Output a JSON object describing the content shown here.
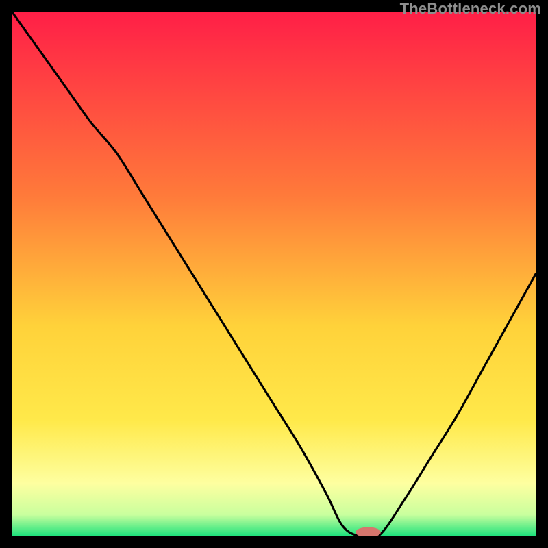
{
  "watermark": "TheBottleneck.com",
  "colors": {
    "black": "#000000",
    "red_top": "#ff1f47",
    "orange": "#ffa331",
    "yellow": "#ffe94a",
    "pale_yellow": "#feffa0",
    "green": "#1fe27c",
    "marker": "#d6766d",
    "curve": "#000000"
  },
  "chart_data": {
    "type": "line",
    "title": "",
    "xlabel": "",
    "ylabel": "",
    "xlim_note": "x in [0,1] fraction of plot width",
    "ylim_note": "y in [0,1] fraction of plot height, 0 at bottom",
    "x": [
      0.0,
      0.05,
      0.1,
      0.15,
      0.2,
      0.25,
      0.3,
      0.35,
      0.4,
      0.45,
      0.5,
      0.55,
      0.6,
      0.63,
      0.66,
      0.7,
      0.75,
      0.8,
      0.85,
      0.9,
      0.95,
      1.0
    ],
    "values": [
      1.0,
      0.93,
      0.86,
      0.79,
      0.73,
      0.65,
      0.57,
      0.49,
      0.41,
      0.33,
      0.25,
      0.17,
      0.08,
      0.02,
      0.0,
      0.0,
      0.07,
      0.15,
      0.23,
      0.32,
      0.41,
      0.5
    ],
    "marker": {
      "x": 0.68,
      "y": 0.0,
      "rx_frac": 0.024,
      "ry_frac": 0.01
    }
  }
}
